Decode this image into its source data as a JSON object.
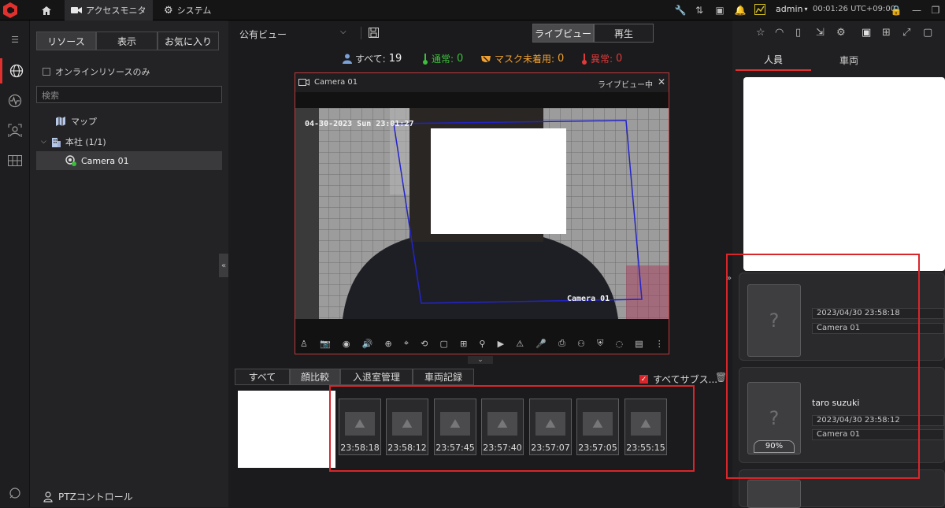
{
  "topbar": {
    "tabs": [
      {
        "label": "アクセスモニタ"
      },
      {
        "label": "システム"
      }
    ],
    "user": "admin",
    "clock": "00:01:26 UTC+09:00"
  },
  "resources": {
    "tabs": [
      "リソース",
      "表示",
      "お気に入り"
    ],
    "online_only_label": "オンラインリソースのみ",
    "search_placeholder": "検索",
    "map_label": "マップ",
    "site_label": "本社 (1/1)",
    "camera_label": "Camera 01",
    "ptz_label": "PTZコントロール"
  },
  "view": {
    "selected_view": "公有ビュー",
    "mode_live": "ライブビュー",
    "mode_playback": "再生"
  },
  "stats": {
    "all_label": "すべて:",
    "all_value": "19",
    "normal_label": "通常:",
    "normal_value": "0",
    "nomask_label": "マスク未着用:",
    "nomask_value": "0",
    "abnormal_label": "異常:",
    "abnormal_value": "0"
  },
  "live": {
    "camera_title": "Camera 01",
    "status": "ライブビュー中",
    "osd_time": "04-30-2023 Sun 23:01:27",
    "osd_name": "Camera 01"
  },
  "events": {
    "tabs": [
      "すべて",
      "顔比較",
      "入退室管理",
      "車両記録"
    ],
    "subscribe_label": "すべてサブス...",
    "thumbnails": [
      "23:58:18",
      "23:58:12",
      "23:57:45",
      "23:57:40",
      "23:57:07",
      "23:57:05",
      "23:55:15"
    ]
  },
  "right": {
    "tabs": [
      "人員",
      "車両"
    ],
    "cards": [
      {
        "name": "",
        "time": "2023/04/30 23:58:18",
        "camera": "Camera 01",
        "score": ""
      },
      {
        "name": "taro suzuki",
        "time": "2023/04/30 23:58:12",
        "camera": "Camera 01",
        "score": "90%"
      }
    ]
  },
  "colors": {
    "accent": "#e0312f",
    "stat_all": "#7aa0d8",
    "stat_normal": "#3cc03c",
    "stat_nomask": "#f0a030",
    "stat_abnormal": "#e03a3a",
    "live_box": "#2424c8"
  }
}
